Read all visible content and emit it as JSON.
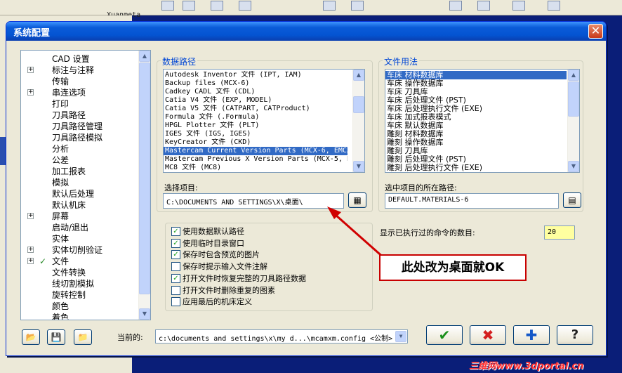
{
  "background_app": {
    "title_fragment": "Xuanmeta"
  },
  "dialog": {
    "title": "系统配置",
    "close_label": "✕",
    "tree": [
      {
        "label": "CAD 设置",
        "expander": false,
        "checked": false
      },
      {
        "label": "标注与注释",
        "expander": true,
        "checked": false
      },
      {
        "label": "传输",
        "expander": false,
        "checked": false
      },
      {
        "label": "串连选项",
        "expander": true,
        "checked": false
      },
      {
        "label": "打印",
        "expander": false,
        "checked": false
      },
      {
        "label": "刀具路径",
        "expander": false,
        "checked": false
      },
      {
        "label": "刀具路径管理",
        "expander": false,
        "checked": false
      },
      {
        "label": "刀具路径模拟",
        "expander": false,
        "checked": false
      },
      {
        "label": "分析",
        "expander": false,
        "checked": false
      },
      {
        "label": "公差",
        "expander": false,
        "checked": false
      },
      {
        "label": "加工报表",
        "expander": false,
        "checked": false
      },
      {
        "label": "模拟",
        "expander": false,
        "checked": false
      },
      {
        "label": "默认后处理",
        "expander": false,
        "checked": false
      },
      {
        "label": "默认机床",
        "expander": false,
        "checked": false
      },
      {
        "label": "屏幕",
        "expander": true,
        "checked": false
      },
      {
        "label": "启动/退出",
        "expander": false,
        "checked": false
      },
      {
        "label": "实体",
        "expander": false,
        "checked": false
      },
      {
        "label": "实体切削验证",
        "expander": true,
        "checked": false
      },
      {
        "label": "文件",
        "expander": true,
        "checked": true
      },
      {
        "label": "文件转换",
        "expander": false,
        "checked": false
      },
      {
        "label": "线切割模拟",
        "expander": false,
        "checked": false
      },
      {
        "label": "旋转控制",
        "expander": false,
        "checked": false
      },
      {
        "label": "颜色",
        "expander": false,
        "checked": false
      },
      {
        "label": "着色",
        "expander": false,
        "checked": false
      }
    ],
    "data_paths": {
      "label": "数据路径",
      "items": [
        {
          "text": "Autodesk Inventor 文件 (IPT, IAM)",
          "selected": false
        },
        {
          "text": "Backup files (MCX-6)",
          "selected": false
        },
        {
          "text": "Cadkey CADL 文件 (CDL)",
          "selected": false
        },
        {
          "text": "Catia V4 文件 (EXP, MODEL)",
          "selected": false
        },
        {
          "text": "Catia V5 文件 (CATPART, CATProduct)",
          "selected": false
        },
        {
          "text": "Formula 文件 (.Formula)",
          "selected": false
        },
        {
          "text": "HPGL Plotter 文件 (PLT)",
          "selected": false
        },
        {
          "text": "IGES 文件 (IGS, IGES)",
          "selected": false
        },
        {
          "text": "KeyCreator 文件 (CKD)",
          "selected": false
        },
        {
          "text": "Mastercam Current Version Parts (MCX-6, EMCX-6",
          "selected": true
        },
        {
          "text": "Mastercam Previous X Version Parts (MCX-5, EM",
          "selected": false
        },
        {
          "text": "MC8 文件 (MC8)",
          "selected": false
        }
      ],
      "select_label": "选择项目:",
      "select_value": "C:\\DOCUMENTS AND SETTINGS\\X\\桌面\\"
    },
    "file_usage": {
      "label": "文件用法",
      "items": [
        {
          "text": "车床 材料数据库",
          "selected": true
        },
        {
          "text": "车床 操作数据库",
          "selected": false
        },
        {
          "text": "车床 刀具库",
          "selected": false
        },
        {
          "text": "车床 后处理文件 (PST)",
          "selected": false
        },
        {
          "text": "车床 后处理执行文件 (EXE)",
          "selected": false
        },
        {
          "text": "车床 加式报表模式",
          "selected": false
        },
        {
          "text": "车床 默认数据库",
          "selected": false
        },
        {
          "text": "雕刻 材料数据库",
          "selected": false
        },
        {
          "text": "雕刻 操作数据库",
          "selected": false
        },
        {
          "text": "雕刻 刀具库",
          "selected": false
        },
        {
          "text": "雕刻 后处理文件 (PST)",
          "selected": false
        },
        {
          "text": "雕刻 后处理执行文件 (EXE)",
          "selected": false
        }
      ],
      "path_label": "选中项目的所在路径:",
      "path_value": "DEFAULT.MATERIALS-6"
    },
    "options": [
      {
        "label": "使用数据默认路径",
        "checked": true
      },
      {
        "label": "使用临时目录窗口",
        "checked": true
      },
      {
        "label": "保存时包含预览的图片",
        "checked": true
      },
      {
        "label": "保存时提示输入文件注解",
        "checked": false
      },
      {
        "label": "打开文件时恢复完整的刀具路径数据",
        "checked": true
      },
      {
        "label": "打开文件时删除重复的图素",
        "checked": false
      },
      {
        "label": "应用最后的机床定义",
        "checked": false
      }
    ],
    "mru": {
      "label": "显示已执行过的命令的数目:",
      "value": "20"
    },
    "current": {
      "label": "当前的:",
      "value": "c:\\documents and settings\\x\\my d...\\mcamxm.config <公制>"
    },
    "buttons": {
      "ok": "✔",
      "cancel": "✖",
      "add": "✚",
      "help": "?"
    }
  },
  "annotation": {
    "text": "此处改为桌面就OK"
  },
  "watermark": "三维网www.3dportal.cn",
  "colors": {
    "selection": "#316ac5",
    "title_bar": "#0454d2",
    "annotation": "#c80000"
  }
}
